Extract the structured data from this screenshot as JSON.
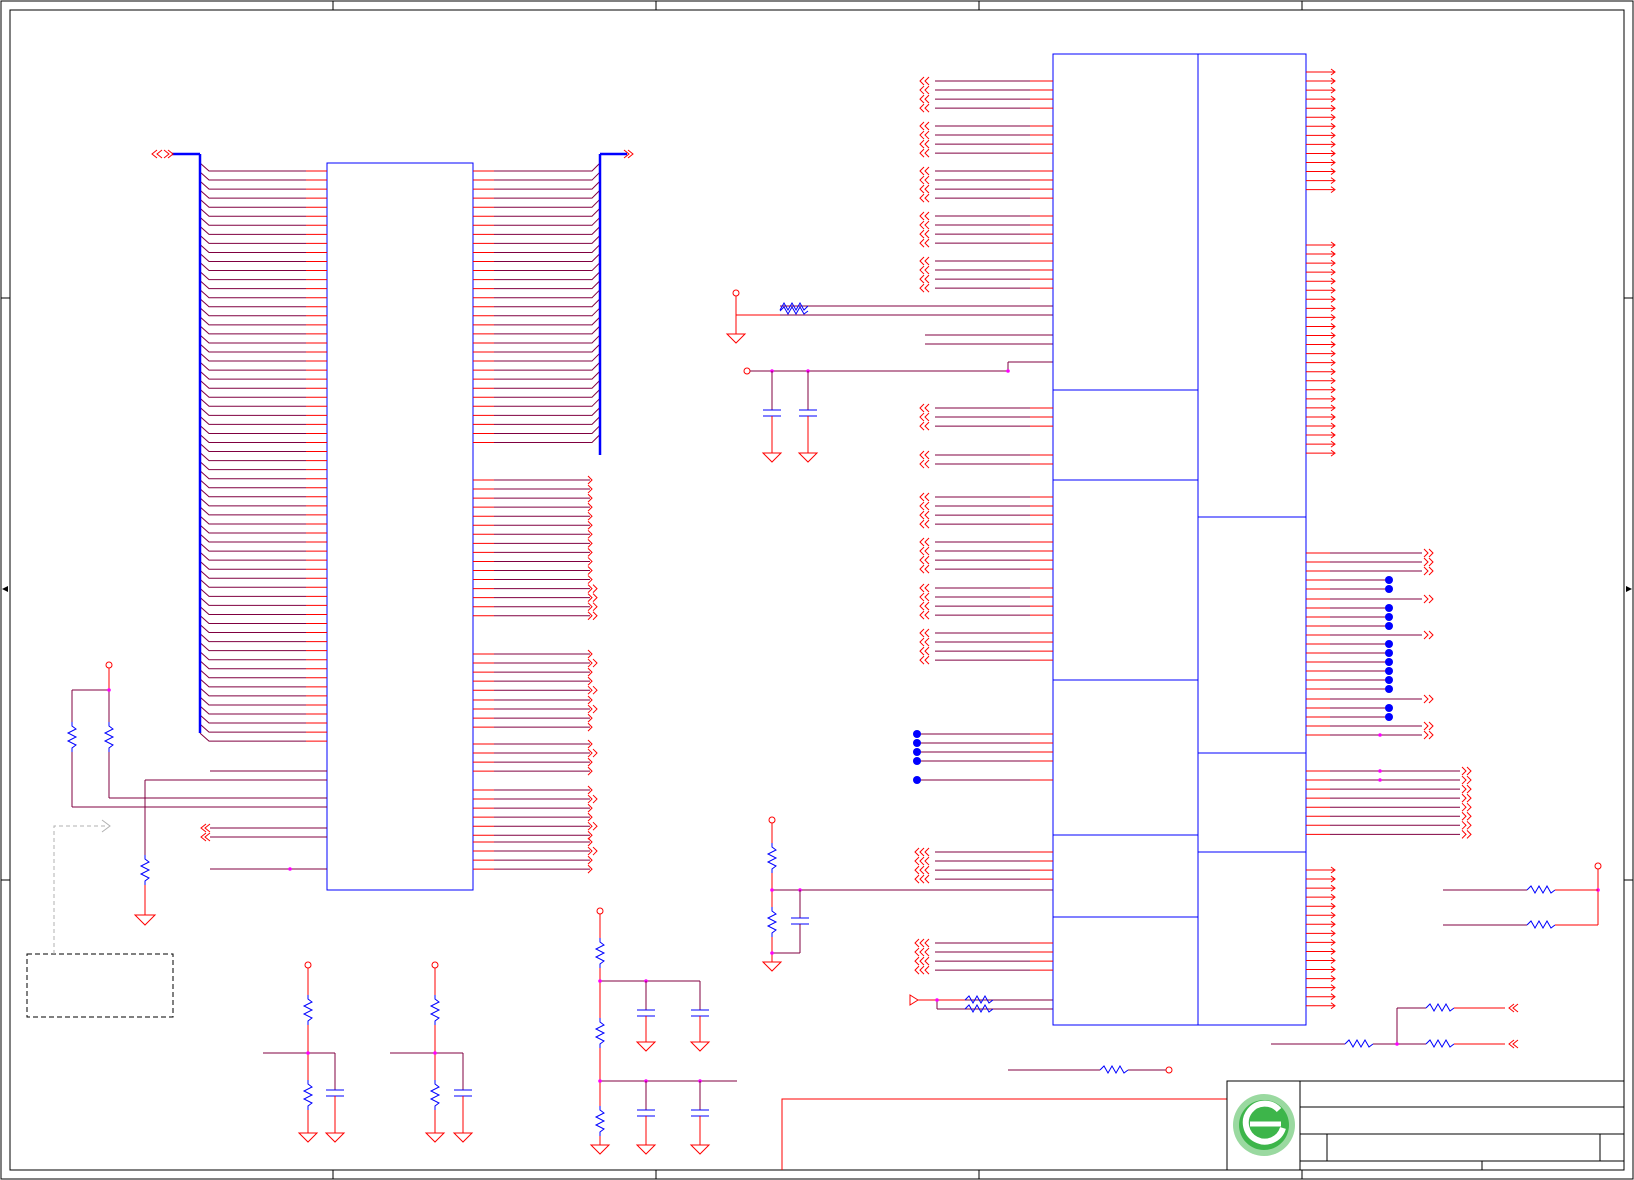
{
  "schematic": {
    "title_block": {
      "logo": "green-e-logo",
      "title": "",
      "document_number": "",
      "revision": "",
      "sheet": ""
    },
    "colors": {
      "border": "#000000",
      "net_wire": "#800040",
      "pin_wire": "#ff0000",
      "component_box": "#0000ff",
      "junction": "#ff00ff",
      "no_connect_dot": "#0000ff",
      "resistor": "#0000ff",
      "capacitor": "#0000ff",
      "logo_green": "#3db54a",
      "logo_light": "#9ad9a0",
      "note_box": "#000000",
      "note_arrow": "#b0b0b0"
    },
    "components": {
      "left_ic": "connector-ic-left",
      "right_ic": "main-ic-multi-unit",
      "resistors": "resistor-symbol",
      "capacitors": "capacitor-symbol",
      "grounds": "ground-symbol",
      "power_ports": "power-port-symbol",
      "off_sheet_ports": "offsheet-connector-symbol"
    }
  }
}
